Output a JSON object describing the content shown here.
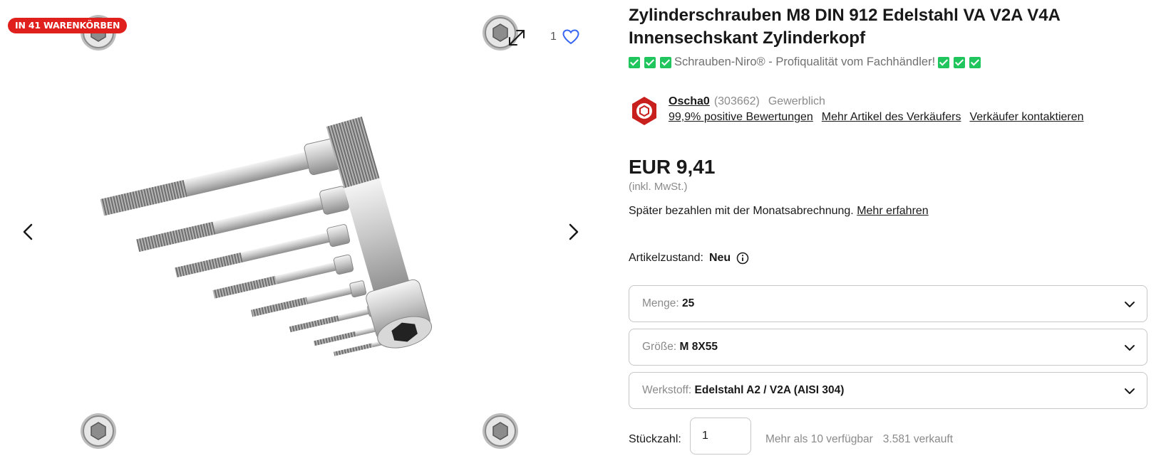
{
  "gallery": {
    "badge": "IN 41 WARENKÖRBEN",
    "watch_count": "1",
    "icons": {
      "expand": "expand-icon",
      "watch": "heart-icon",
      "prev": "chevron-left-icon",
      "next": "chevron-right-icon"
    }
  },
  "product": {
    "title": "Zylinderschrauben M8 DIN 912 Edelstahl VA V2A V4A Innensechskant Zylinderkopf",
    "subtitle": "Schrauben-Niro® - Profiqualität vom Fachhändler!",
    "price": "EUR 9,41",
    "tax_note": "(inkl. MwSt.)",
    "pay_later_text": "Später bezahlen mit der Monatsabrechnung.",
    "pay_later_link": "Mehr erfahren"
  },
  "seller": {
    "name": "Oscha0",
    "feedback_count": "(303662)",
    "type": "Gewerblich",
    "positive": "99,9% positive Bewertungen",
    "more_items": "Mehr Artikel des Verkäufers",
    "contact": "Verkäufer kontaktieren"
  },
  "condition": {
    "label": "Artikelzustand:",
    "value": "Neu"
  },
  "options": [
    {
      "label": "Menge:",
      "value": "25"
    },
    {
      "label": "Größe:",
      "value": "M 8X55"
    },
    {
      "label": "Werkstoff:",
      "value": "Edelstahl A2 / V2A (AISI 304)"
    }
  ],
  "quantity": {
    "label": "Stückzahl:",
    "value": "1",
    "available": "Mehr als 10 verfügbar",
    "sold": "3.581 verkauft"
  },
  "colors": {
    "badge_red": "#e0201c",
    "check_green": "#21c55d",
    "watch_blue": "#3665f3"
  }
}
